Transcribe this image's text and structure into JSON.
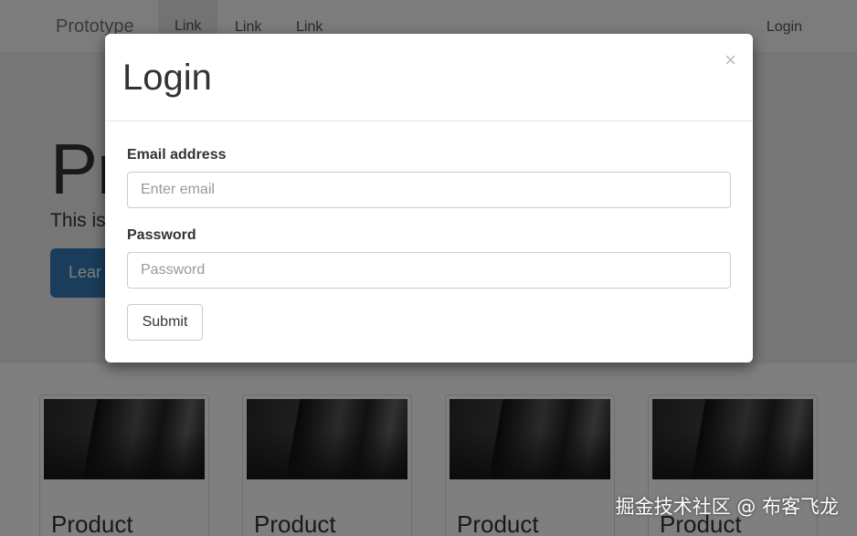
{
  "navbar": {
    "brand": "Prototype",
    "links": [
      "Link",
      "Link",
      "Link"
    ],
    "right_link": "Login"
  },
  "jumbotron": {
    "title": "Pr",
    "lead": "This is",
    "button_label": "Lear"
  },
  "cards": [
    {
      "title": "Product"
    },
    {
      "title": "Product"
    },
    {
      "title": "Product"
    },
    {
      "title": "Product"
    }
  ],
  "modal": {
    "title": "Login",
    "close_glyph": "×",
    "email": {
      "label": "Email address",
      "placeholder": "Enter email",
      "value": ""
    },
    "password": {
      "label": "Password",
      "placeholder": "Password",
      "value": ""
    },
    "submit_label": "Submit"
  },
  "watermark": "掘金技术社区 @ 布客飞龙",
  "colors": {
    "primary": "#337ab7",
    "backdrop": "rgba(0,0,0,0.5)"
  }
}
